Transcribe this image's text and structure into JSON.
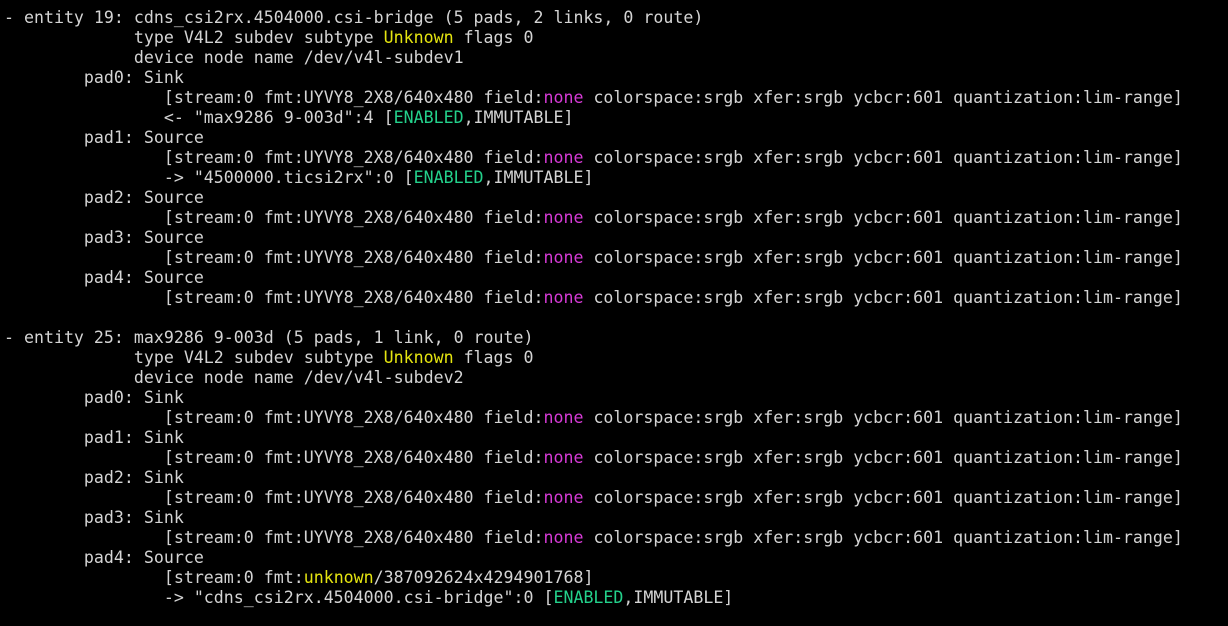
{
  "colors": {
    "background": "#000000",
    "default": "#d4d4d4",
    "yellow": "#e5e510",
    "magenta": "#d63ad6",
    "green": "#23d18b"
  },
  "terminal": {
    "lines": [
      {
        "segments": [
          {
            "text": "- entity 19: cdns_csi2rx.4504000.csi-bridge (5 pads, 2 links, 0 route)",
            "color": "default"
          }
        ]
      },
      {
        "segments": [
          {
            "text": "             type V4L2 subdev subtype ",
            "color": "default"
          },
          {
            "text": "Unknown",
            "color": "yellow"
          },
          {
            "text": " flags 0",
            "color": "default"
          }
        ]
      },
      {
        "segments": [
          {
            "text": "             device node name /dev/v4l-subdev1",
            "color": "default"
          }
        ]
      },
      {
        "segments": [
          {
            "text": "        pad0: Sink",
            "color": "default"
          }
        ]
      },
      {
        "segments": [
          {
            "text": "                [stream:0 fmt:UYVY8_2X8/640x480 field:",
            "color": "default"
          },
          {
            "text": "none",
            "color": "magenta"
          },
          {
            "text": " colorspace:srgb xfer:srgb ycbcr:601 quantization:lim-range]",
            "color": "default"
          }
        ]
      },
      {
        "segments": [
          {
            "text": "                <- \"max9286 9-003d\":4 [",
            "color": "default"
          },
          {
            "text": "ENABLED",
            "color": "green"
          },
          {
            "text": ",IMMUTABLE]",
            "color": "default"
          }
        ]
      },
      {
        "segments": [
          {
            "text": "        pad1: Source",
            "color": "default"
          }
        ]
      },
      {
        "segments": [
          {
            "text": "                [stream:0 fmt:UYVY8_2X8/640x480 field:",
            "color": "default"
          },
          {
            "text": "none",
            "color": "magenta"
          },
          {
            "text": " colorspace:srgb xfer:srgb ycbcr:601 quantization:lim-range]",
            "color": "default"
          }
        ]
      },
      {
        "segments": [
          {
            "text": "                -> \"4500000.ticsi2rx\":0 [",
            "color": "default"
          },
          {
            "text": "ENABLED",
            "color": "green"
          },
          {
            "text": ",IMMUTABLE]",
            "color": "default"
          }
        ]
      },
      {
        "segments": [
          {
            "text": "        pad2: Source",
            "color": "default"
          }
        ]
      },
      {
        "segments": [
          {
            "text": "                [stream:0 fmt:UYVY8_2X8/640x480 field:",
            "color": "default"
          },
          {
            "text": "none",
            "color": "magenta"
          },
          {
            "text": " colorspace:srgb xfer:srgb ycbcr:601 quantization:lim-range]",
            "color": "default"
          }
        ]
      },
      {
        "segments": [
          {
            "text": "        pad3: Source",
            "color": "default"
          }
        ]
      },
      {
        "segments": [
          {
            "text": "                [stream:0 fmt:UYVY8_2X8/640x480 field:",
            "color": "default"
          },
          {
            "text": "none",
            "color": "magenta"
          },
          {
            "text": " colorspace:srgb xfer:srgb ycbcr:601 quantization:lim-range]",
            "color": "default"
          }
        ]
      },
      {
        "segments": [
          {
            "text": "        pad4: Source",
            "color": "default"
          }
        ]
      },
      {
        "segments": [
          {
            "text": "                [stream:0 fmt:UYVY8_2X8/640x480 field:",
            "color": "default"
          },
          {
            "text": "none",
            "color": "magenta"
          },
          {
            "text": " colorspace:srgb xfer:srgb ycbcr:601 quantization:lim-range]",
            "color": "default"
          }
        ]
      },
      {
        "segments": [
          {
            "text": "",
            "color": "default"
          }
        ]
      },
      {
        "segments": [
          {
            "text": "- entity 25: max9286 9-003d (5 pads, 1 link, 0 route)",
            "color": "default"
          }
        ]
      },
      {
        "segments": [
          {
            "text": "             type V4L2 subdev subtype ",
            "color": "default"
          },
          {
            "text": "Unknown",
            "color": "yellow"
          },
          {
            "text": " flags 0",
            "color": "default"
          }
        ]
      },
      {
        "segments": [
          {
            "text": "             device node name /dev/v4l-subdev2",
            "color": "default"
          }
        ]
      },
      {
        "segments": [
          {
            "text": "        pad0: Sink",
            "color": "default"
          }
        ]
      },
      {
        "segments": [
          {
            "text": "                [stream:0 fmt:UYVY8_2X8/640x480 field:",
            "color": "default"
          },
          {
            "text": "none",
            "color": "magenta"
          },
          {
            "text": " colorspace:srgb xfer:srgb ycbcr:601 quantization:lim-range]",
            "color": "default"
          }
        ]
      },
      {
        "segments": [
          {
            "text": "        pad1: Sink",
            "color": "default"
          }
        ]
      },
      {
        "segments": [
          {
            "text": "                [stream:0 fmt:UYVY8_2X8/640x480 field:",
            "color": "default"
          },
          {
            "text": "none",
            "color": "magenta"
          },
          {
            "text": " colorspace:srgb xfer:srgb ycbcr:601 quantization:lim-range]",
            "color": "default"
          }
        ]
      },
      {
        "segments": [
          {
            "text": "        pad2: Sink",
            "color": "default"
          }
        ]
      },
      {
        "segments": [
          {
            "text": "                [stream:0 fmt:UYVY8_2X8/640x480 field:",
            "color": "default"
          },
          {
            "text": "none",
            "color": "magenta"
          },
          {
            "text": " colorspace:srgb xfer:srgb ycbcr:601 quantization:lim-range]",
            "color": "default"
          }
        ]
      },
      {
        "segments": [
          {
            "text": "        pad3: Sink",
            "color": "default"
          }
        ]
      },
      {
        "segments": [
          {
            "text": "                [stream:0 fmt:UYVY8_2X8/640x480 field:",
            "color": "default"
          },
          {
            "text": "none",
            "color": "magenta"
          },
          {
            "text": " colorspace:srgb xfer:srgb ycbcr:601 quantization:lim-range]",
            "color": "default"
          }
        ]
      },
      {
        "segments": [
          {
            "text": "        pad4: Source",
            "color": "default"
          }
        ]
      },
      {
        "segments": [
          {
            "text": "                [stream:0 fmt:",
            "color": "default"
          },
          {
            "text": "unknown",
            "color": "yellow"
          },
          {
            "text": "/387092624x4294901768]",
            "color": "default"
          }
        ]
      },
      {
        "segments": [
          {
            "text": "                -> \"cdns_csi2rx.4504000.csi-bridge\":0 [",
            "color": "default"
          },
          {
            "text": "ENABLED",
            "color": "green"
          },
          {
            "text": ",IMMUTABLE]",
            "color": "default"
          }
        ]
      }
    ]
  }
}
